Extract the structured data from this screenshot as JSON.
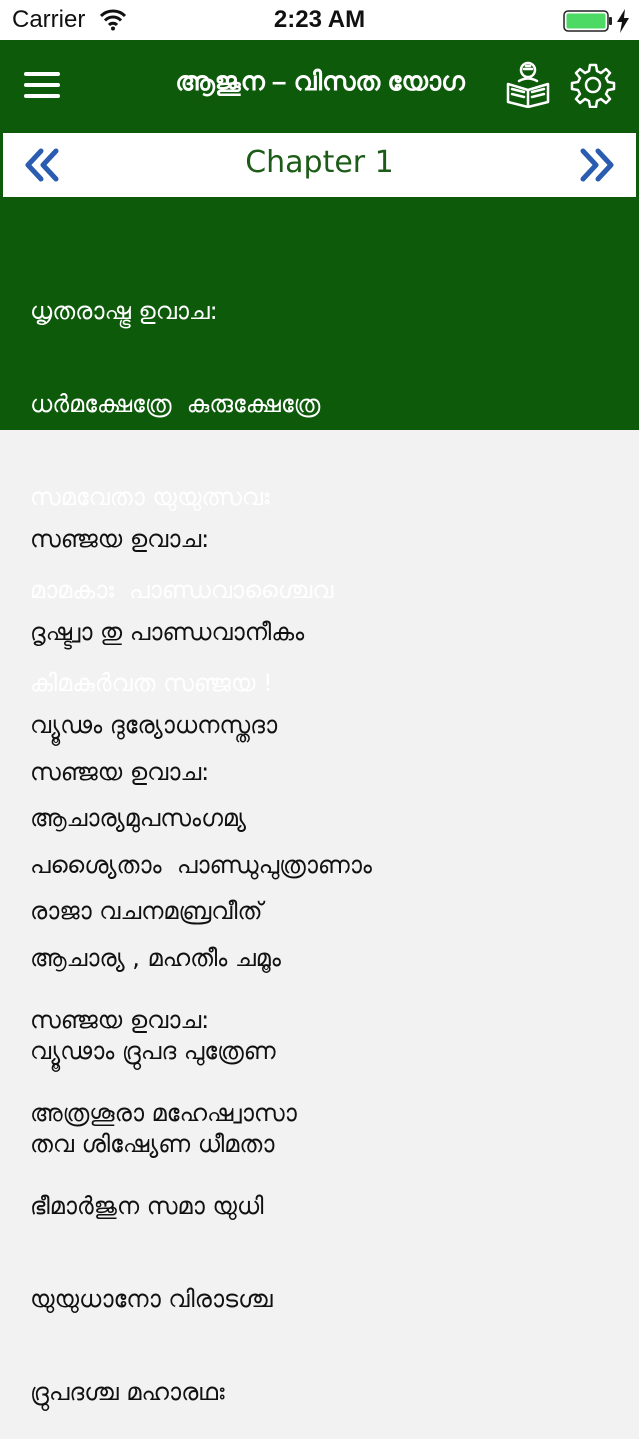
{
  "status_bar": {
    "carrier": "Carrier",
    "time": "2:23 AM",
    "wifi_icon": "wifi-icon",
    "battery_icon": "battery-icon",
    "battery_color": "#4cd964"
  },
  "nav": {
    "title": "ആജൂന – വിസത യോഗ",
    "menu_icon": "hamburger-menu-icon",
    "book_icon": "reading-book-icon",
    "settings_icon": "gear-icon",
    "background": "#0e5a0b"
  },
  "chapter": {
    "title": "Chapter 1",
    "prev_icon": "double-chevron-left-icon",
    "next_icon": "double-chevron-right-icon",
    "accent": "#2a5db0"
  },
  "verses": [
    {
      "highlighted": true,
      "lines": [
        "ധൃതരാഷ്ട്ര ഉവാച:",
        "ധർമക്ഷേത്രേ  കുരുക്ഷേത്രേ",
        "സമവേതാ യുയുത്സവഃ",
        "മാമകാഃ  പാണ്ഡവാശ്ചൈവ",
        "കിമകുർവത സഞ്ജയ !"
      ]
    },
    {
      "highlighted": false,
      "lines": [
        "സഞ്ജയ ഉവാച:",
        "ദൃഷ്ട്വാ തു പാണ്ഡവാനീകം",
        "വ്യൂഢം ദുര്യോധനസ്തദാ",
        "ആചാര്യമുപസംഗമ്യ",
        "രാജാ വചനമബ്രവീത്"
      ]
    },
    {
      "highlighted": false,
      "lines": [
        "സഞ്ജയ ഉവാച:",
        "പശ്യൈതാം  പാണ്ഡുപുത്രാണാം",
        "ആചാര്യ , മഹതീം ചമൂം",
        "വ്യൂഢാം ദ്രുപദ പുത്രേണ",
        "തവ ശിഷ്യേണ ധീമതാ"
      ]
    },
    {
      "highlighted": false,
      "lines": [
        "സഞ്ജയ ഉവാച:",
        "അത്രശൂരാ മഹേഷ്വാസാ",
        "ഭീമാർജുന സമാ യുധി",
        "യുയുധാനോ വിരാടശ്ച",
        "ദ്രുപദശ്ച മഹാരഥഃ"
      ]
    }
  ]
}
